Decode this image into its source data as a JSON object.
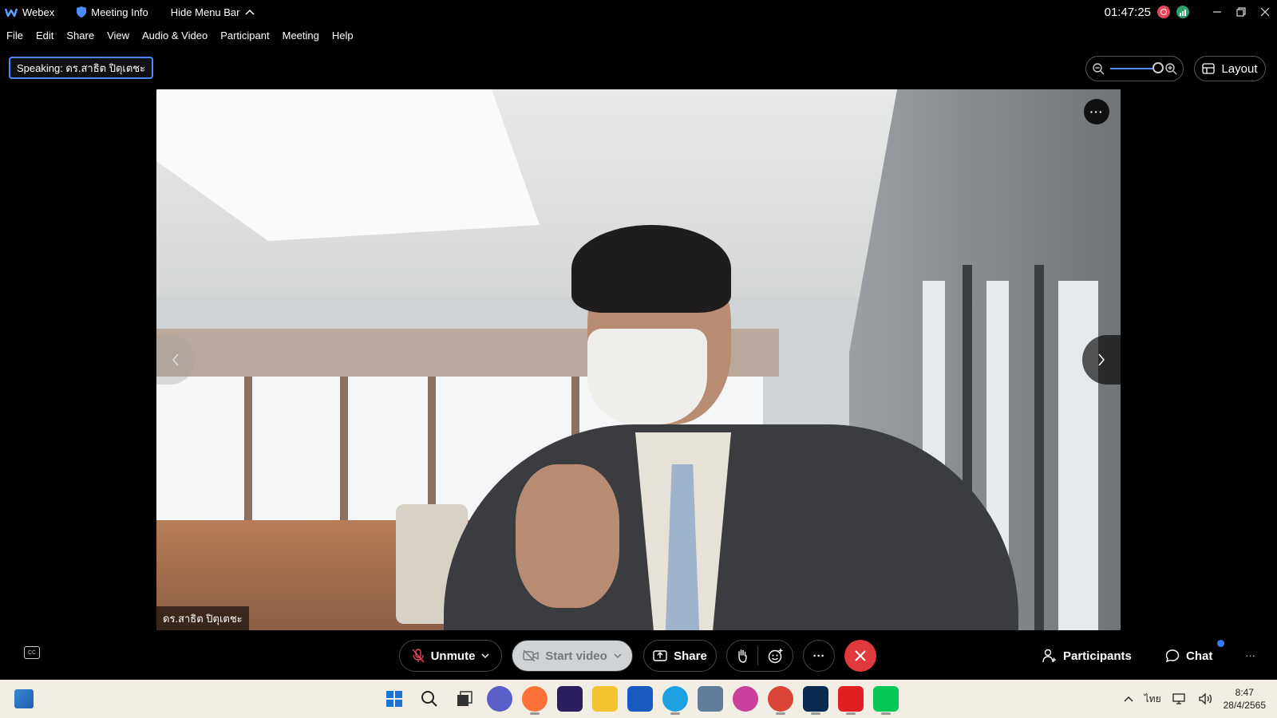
{
  "titlebar": {
    "app_name": "Webex",
    "meeting_info": "Meeting Info",
    "hide_menu_bar": "Hide Menu Bar",
    "clock": "01:47:25"
  },
  "menu": [
    "File",
    "Edit",
    "Share",
    "View",
    "Audio & Video",
    "Participant",
    "Meeting",
    "Help"
  ],
  "speaking_label": "Speaking: ดร.สาธิต ปิตุเตชะ",
  "layout_label": "Layout",
  "video": {
    "participant_name": "ดร.สาธิต ปิตุเตชะ"
  },
  "controls": {
    "unmute": "Unmute",
    "start_video": "Start video",
    "share": "Share",
    "participants": "Participants",
    "chat": "Chat"
  },
  "taskbar": {
    "lang": "ไทย",
    "time": "8:47",
    "date": "28/4/2565",
    "apps": [
      {
        "name": "start-icon",
        "color": "#1a73d9"
      },
      {
        "name": "search-icon",
        "color": "#333333"
      },
      {
        "name": "task-view-icon",
        "color": "#333333"
      },
      {
        "name": "teams-chat-icon",
        "color": "#5b5fc7"
      },
      {
        "name": "firefox-icon",
        "color": "#ff7139"
      },
      {
        "name": "premiere-icon",
        "color": "#2a1e5c"
      },
      {
        "name": "file-explorer-icon",
        "color": "#f4c430"
      },
      {
        "name": "word-icon",
        "color": "#185abd"
      },
      {
        "name": "edge-icon",
        "color": "#1fa0e0"
      },
      {
        "name": "store-icon",
        "color": "#607d9b"
      },
      {
        "name": "picasa-icon",
        "color": "#c83f9c"
      },
      {
        "name": "chrome-icon",
        "color": "#db4437"
      },
      {
        "name": "webex-icon",
        "color": "#0b2a52"
      },
      {
        "name": "acrobat-icon",
        "color": "#e02020"
      },
      {
        "name": "line-icon",
        "color": "#06c755"
      }
    ]
  },
  "colors": {
    "accent": "#4a8cff",
    "end_call": "#e03a3e",
    "recording": "#e8445a"
  }
}
